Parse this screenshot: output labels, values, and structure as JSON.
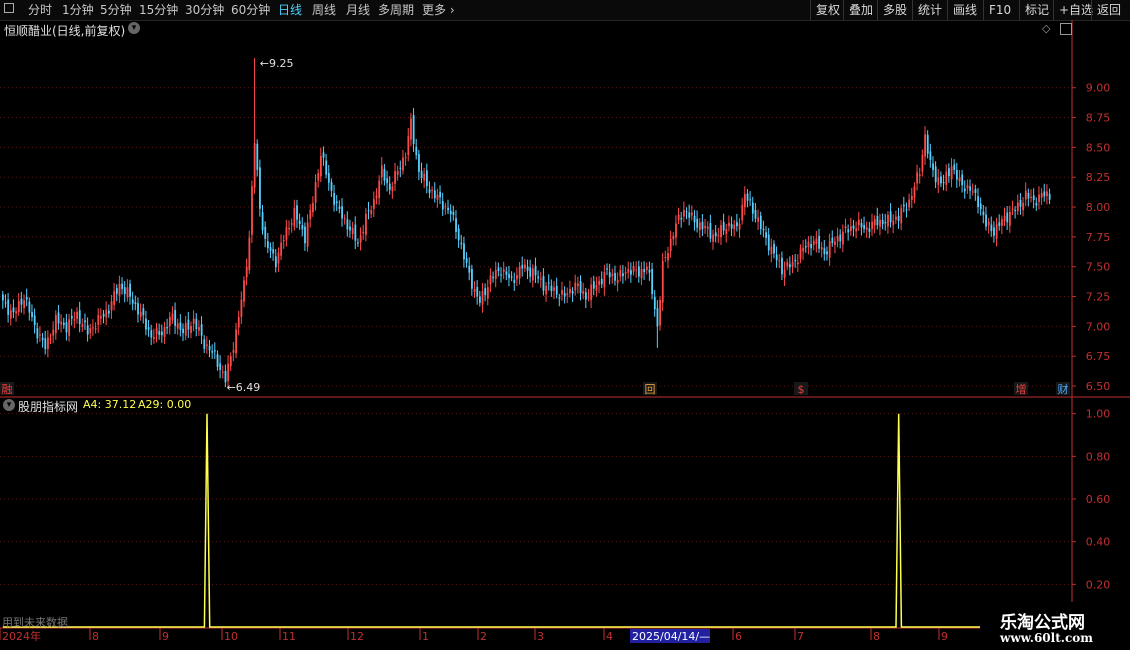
{
  "toolbar": {
    "left_items": [
      "分时",
      "1分钟",
      "5分钟",
      "15分钟",
      "30分钟",
      "60分钟",
      "日线",
      "周线",
      "月线",
      "多周期",
      "更多"
    ],
    "active": "日线",
    "right_items": [
      "复权",
      "叠加",
      "多股",
      "统计",
      "画线",
      "F10",
      "标记",
      "+自选",
      "返回"
    ]
  },
  "stock_title": "恒顺醋业(日线,前复权)",
  "indicator_title": "股朋指标网",
  "indicator_values": {
    "a4": "A4: 37.12",
    "a29": "A29: 0.00"
  },
  "future_note": "用到未来数据",
  "watermark": {
    "line1": "乐淘公式网",
    "line2": "www.60lt.com"
  },
  "event_markers": [
    {
      "label": "融",
      "color": "#e04040"
    },
    {
      "label": "回",
      "color": "#e8a040"
    },
    {
      "label": "$",
      "color": "#e04040"
    },
    {
      "label": "增",
      "color": "#e04040"
    },
    {
      "label": "财",
      "color": "#4fa8ff"
    }
  ],
  "colors": {
    "up": "#ff4a4a",
    "down": "#58d0ff",
    "axis": "#c03030",
    "indicator_line": "#ffff50",
    "selected_date_bg": "#2020a0"
  },
  "chart_data": [
    {
      "type": "candlestick",
      "title": "恒顺醋业(日线,前复权)",
      "yticks": [
        6.5,
        6.75,
        7.0,
        7.25,
        7.5,
        7.75,
        8.0,
        8.25,
        8.5,
        8.75,
        9.0
      ],
      "ylim": [
        6.45,
        9.4
      ],
      "grid": true,
      "high_label": "9.25",
      "low_label": "6.49",
      "anchors": [
        [
          0,
          7.2
        ],
        [
          4,
          7.1
        ],
        [
          8,
          7.25
        ],
        [
          12,
          7.0
        ],
        [
          16,
          6.82
        ],
        [
          20,
          7.05
        ],
        [
          24,
          7.0
        ],
        [
          28,
          7.1
        ],
        [
          32,
          6.95
        ],
        [
          36,
          7.05
        ],
        [
          40,
          7.15
        ],
        [
          44,
          7.35
        ],
        [
          48,
          7.25
        ],
        [
          52,
          7.1
        ],
        [
          56,
          6.92
        ],
        [
          60,
          6.95
        ],
        [
          64,
          7.08
        ],
        [
          68,
          6.95
        ],
        [
          72,
          7.05
        ],
        [
          76,
          6.86
        ],
        [
          80,
          6.75
        ],
        [
          84,
          6.55
        ],
        [
          88,
          6.95
        ],
        [
          91,
          7.35
        ],
        [
          93,
          7.75
        ],
        [
          95,
          8.55
        ],
        [
          97,
          8.0
        ],
        [
          99,
          7.7
        ],
        [
          103,
          7.55
        ],
        [
          107,
          7.8
        ],
        [
          110,
          7.95
        ],
        [
          114,
          7.75
        ],
        [
          117,
          8.05
        ],
        [
          120,
          8.45
        ],
        [
          123,
          8.2
        ],
        [
          126,
          8.0
        ],
        [
          130,
          7.85
        ],
        [
          134,
          7.7
        ],
        [
          137,
          7.9
        ],
        [
          140,
          8.05
        ],
        [
          143,
          8.3
        ],
        [
          146,
          8.15
        ],
        [
          149,
          8.3
        ],
        [
          152,
          8.45
        ],
        [
          154,
          8.7
        ],
        [
          157,
          8.3
        ],
        [
          161,
          8.15
        ],
        [
          165,
          8.05
        ],
        [
          169,
          7.95
        ],
        [
          172,
          7.75
        ],
        [
          175,
          7.5
        ],
        [
          178,
          7.3
        ],
        [
          180,
          7.2
        ],
        [
          184,
          7.4
        ],
        [
          188,
          7.48
        ],
        [
          192,
          7.38
        ],
        [
          196,
          7.5
        ],
        [
          200,
          7.45
        ],
        [
          204,
          7.35
        ],
        [
          208,
          7.3
        ],
        [
          212,
          7.25
        ],
        [
          216,
          7.35
        ],
        [
          220,
          7.25
        ],
        [
          224,
          7.35
        ],
        [
          228,
          7.45
        ],
        [
          232,
          7.4
        ],
        [
          236,
          7.48
        ],
        [
          240,
          7.45
        ],
        [
          243,
          7.5
        ],
        [
          245,
          7.3
        ],
        [
          247,
          7.0
        ],
        [
          249,
          7.5
        ],
        [
          251,
          7.65
        ],
        [
          254,
          7.85
        ],
        [
          257,
          7.98
        ],
        [
          261,
          7.88
        ],
        [
          265,
          7.82
        ],
        [
          269,
          7.75
        ],
        [
          273,
          7.85
        ],
        [
          277,
          7.82
        ],
        [
          280,
          8.1
        ],
        [
          283,
          7.98
        ],
        [
          287,
          7.78
        ],
        [
          291,
          7.6
        ],
        [
          294,
          7.48
        ],
        [
          298,
          7.52
        ],
        [
          302,
          7.65
        ],
        [
          306,
          7.72
        ],
        [
          310,
          7.62
        ],
        [
          314,
          7.72
        ],
        [
          318,
          7.8
        ],
        [
          322,
          7.85
        ],
        [
          326,
          7.82
        ],
        [
          330,
          7.88
        ],
        [
          334,
          7.88
        ],
        [
          338,
          7.92
        ],
        [
          342,
          8.05
        ],
        [
          346,
          8.3
        ],
        [
          348,
          8.6
        ],
        [
          350,
          8.35
        ],
        [
          352,
          8.25
        ],
        [
          355,
          8.2
        ],
        [
          358,
          8.35
        ],
        [
          361,
          8.2
        ],
        [
          365,
          8.15
        ],
        [
          368,
          8.05
        ],
        [
          371,
          7.85
        ],
        [
          374,
          7.8
        ],
        [
          377,
          7.88
        ],
        [
          380,
          7.95
        ],
        [
          383,
          8.0
        ],
        [
          386,
          8.1
        ],
        [
          389,
          8.05
        ],
        [
          392,
          8.1
        ],
        [
          395,
          8.1
        ]
      ]
    },
    {
      "type": "line",
      "title": "股朋指标网",
      "series": [
        {
          "name": "A4",
          "last_value": 37.12
        },
        {
          "name": "A29",
          "last_value": 0.0
        }
      ],
      "yticks": [
        0.2,
        0.4,
        0.6,
        0.8,
        1.0
      ],
      "ylim": [
        0,
        1.05
      ],
      "grid": true,
      "x_labels": [
        "2024年",
        "8",
        "9",
        "10",
        "11",
        "12",
        "1",
        "2",
        "3",
        "4",
        "2025/04/14/—",
        "6",
        "7",
        "8",
        "9"
      ],
      "selected_date": "2025/04/14/—"
    }
  ]
}
